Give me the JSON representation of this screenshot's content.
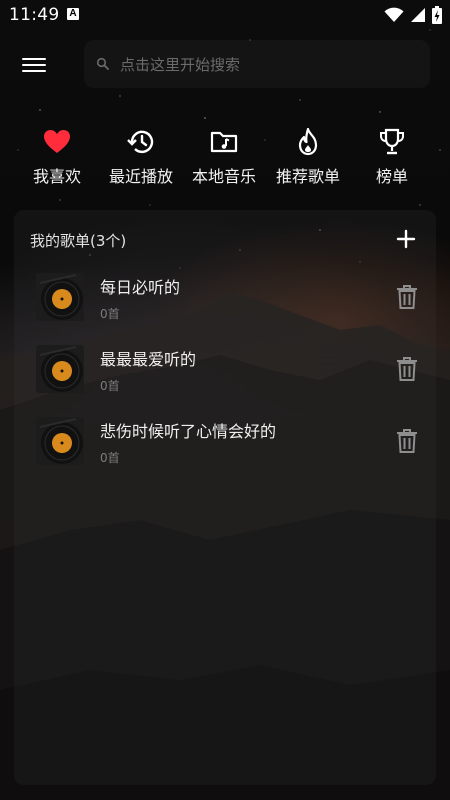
{
  "status_bar": {
    "time": "11:49",
    "a_badge": "A",
    "icons": [
      "a-notification-icon",
      "wifi-icon",
      "signal-icon",
      "battery-charging-icon"
    ]
  },
  "top_bar": {
    "menu_icon": "hamburger-menu-icon",
    "search": {
      "placeholder": "点击这里开始搜索",
      "icon": "search-icon"
    }
  },
  "quick_nav": [
    {
      "label": "我喜欢",
      "icon": "heart-icon",
      "color": "#ff2d3c"
    },
    {
      "label": "最近播放",
      "icon": "history-clock-icon"
    },
    {
      "label": "本地音乐",
      "icon": "music-folder-icon"
    },
    {
      "label": "推荐歌单",
      "icon": "flame-icon"
    },
    {
      "label": "榜单",
      "icon": "trophy-icon"
    }
  ],
  "playlists": {
    "title": "我的歌单(3个)",
    "add_icon": "plus-icon",
    "items": [
      {
        "name": "每日必听的",
        "count": "0首"
      },
      {
        "name": "最最最爱听的",
        "count": "0首"
      },
      {
        "name": "悲伤时候听了心情会好的",
        "count": "0首"
      }
    ],
    "delete_icon": "trash-icon"
  }
}
